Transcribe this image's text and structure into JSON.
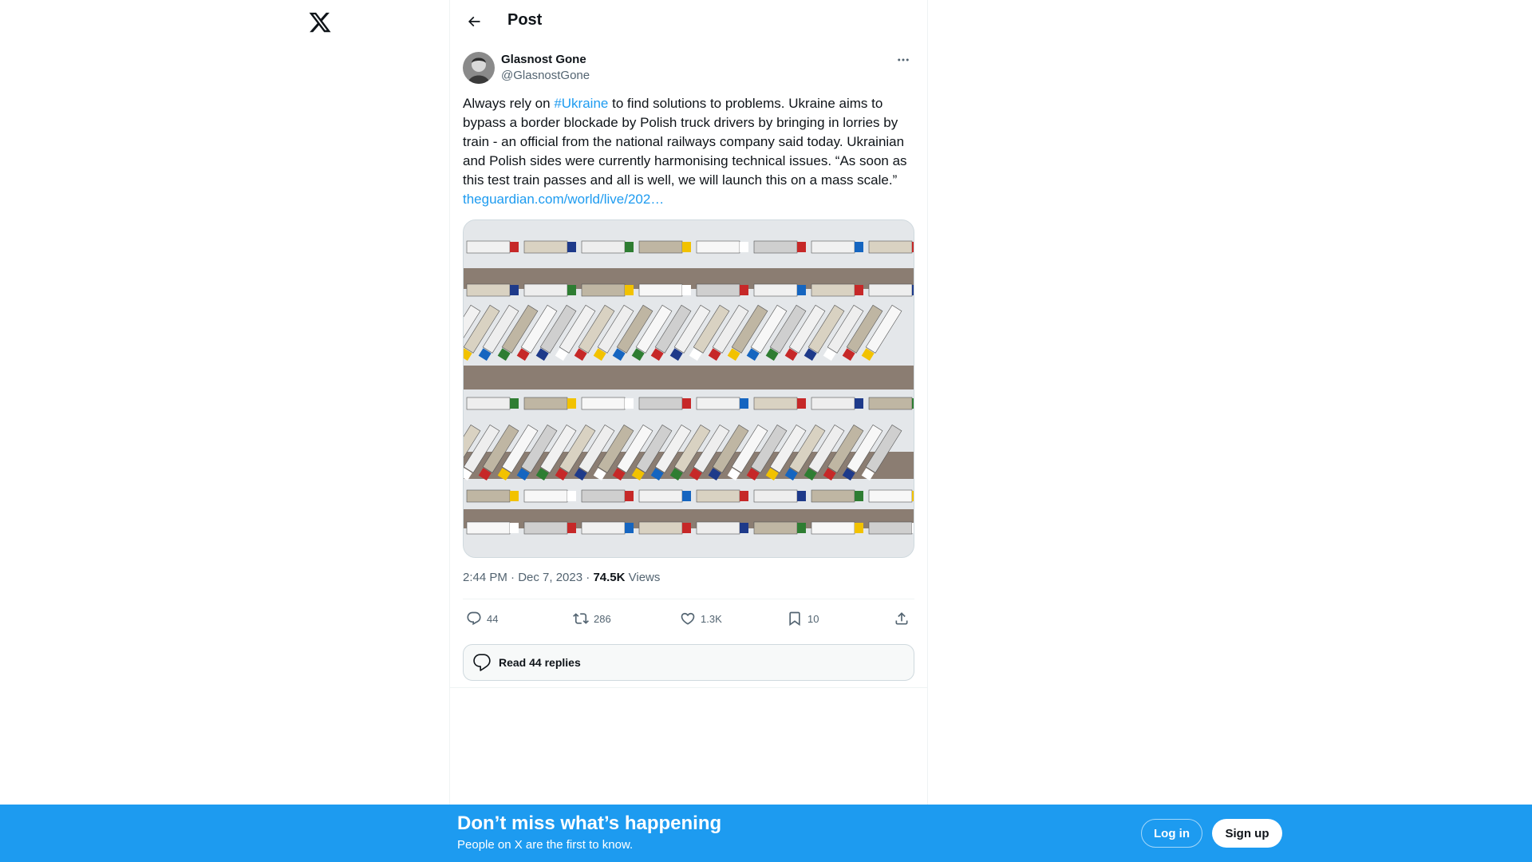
{
  "header": {
    "title": "Post"
  },
  "post": {
    "author": {
      "name": "Glasnost Gone",
      "handle": "@GlasnostGone"
    },
    "text": {
      "part1": "Always rely on ",
      "hashtag": "#Ukraine",
      "part2": " to find solutions to problems. Ukraine aims to bypass a border blockade by Polish truck drivers by bringing in lorries by train - an official from the national railways company said today. Ukrainian and Polish sides were currently harmonising technical issues. “As soon as this test train passes and all is well, we will launch this on a mass scale.” ",
      "link": "theguardian.com/world/live/202…"
    },
    "timestamp": "2:44 PM · Dec 7, 2023",
    "views_count": "74.5K",
    "views_label": "Views",
    "stats": {
      "replies": "44",
      "reposts": "286",
      "likes": "1.3K",
      "bookmarks": "10"
    },
    "read_replies": "Read 44 replies"
  },
  "banner": {
    "title": "Don’t miss what’s happening",
    "subtitle": "People on X are the first to know.",
    "login": "Log in",
    "signup": "Sign up"
  },
  "colors": {
    "accent": "#1d9bf0",
    "text": "#0f1419",
    "secondary": "#536471"
  }
}
